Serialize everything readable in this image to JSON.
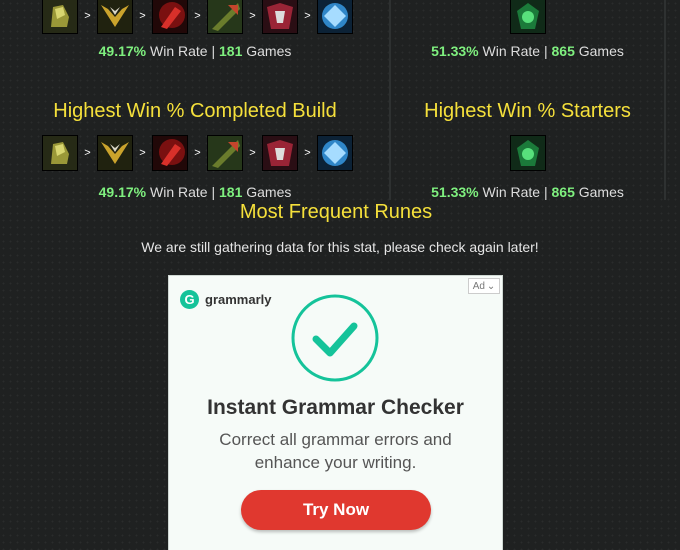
{
  "sections": {
    "top_left_stat": {
      "win_pct": "49.17%",
      "win_label": "Win Rate |",
      "games": "181",
      "games_label": "Games"
    },
    "top_right_stat": {
      "win_pct": "51.33%",
      "win_label": "Win Rate |",
      "games": "865",
      "games_label": "Games"
    },
    "completed_build": {
      "title": "Highest Win % Completed Build",
      "stat": {
        "win_pct": "49.17%",
        "win_label": "Win Rate |",
        "games": "181",
        "games_label": "Games"
      }
    },
    "starters": {
      "title": "Highest Win % Starters",
      "stat": {
        "win_pct": "51.33%",
        "win_label": "Win Rate |",
        "games": "865",
        "games_label": "Games"
      }
    }
  },
  "build_arrow": ">",
  "items": {
    "build": [
      "mercury-treads-icon",
      "ravenous-hydra-icon",
      "titanic-hydra-icon",
      "black-cleaver-icon",
      "deaths-dance-icon",
      "guardian-angel-icon"
    ],
    "starter": [
      "corrupting-potion-icon"
    ]
  },
  "runes": {
    "title": "Most Frequent Runes",
    "message": "We are still gathering data for this stat, please check again later!"
  },
  "ad": {
    "badge": "Ad",
    "brand": "grammarly",
    "title": "Instant Grammar Checker",
    "subtitle": "Correct all grammar errors and enhance your writing.",
    "cta": "Try Now",
    "colors": {
      "brand": "#15c39a",
      "cta": "#e0382f"
    }
  },
  "colors": {
    "title": "#f5e03b",
    "win": "#7ff07f",
    "background": "#1f2121"
  }
}
